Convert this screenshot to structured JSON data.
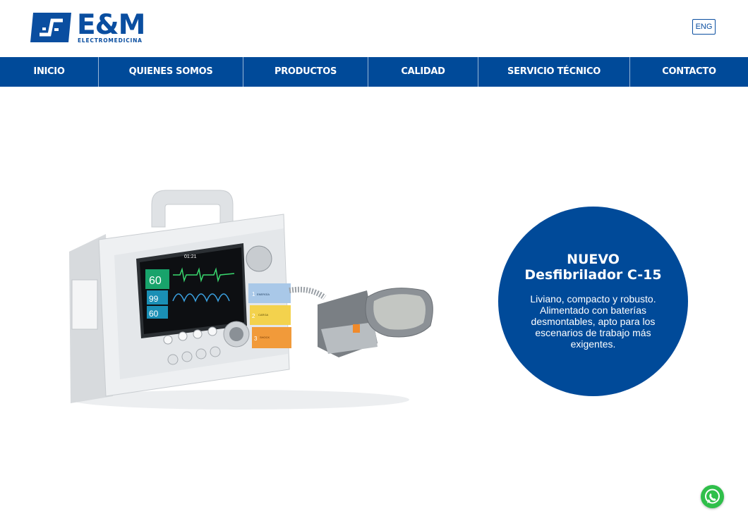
{
  "brand": {
    "name": "E&M",
    "subtitle": "ELECTROMEDICINA",
    "color": "#0a4ea0"
  },
  "header": {
    "language_button": "ENG"
  },
  "nav": {
    "background": "#004a99",
    "items": [
      {
        "label": "INICIO"
      },
      {
        "label": "QUIENES SOMOS"
      },
      {
        "label": "PRODUCTOS"
      },
      {
        "label": "CALIDAD"
      },
      {
        "label": "SERVICIO TÉCNICO"
      },
      {
        "label": "CONTACTO"
      }
    ]
  },
  "hero": {
    "product_image": "defibrillator-image",
    "screen": {
      "time": "01:21",
      "hr": "60",
      "spo2": "99",
      "pulse": "60"
    },
    "panel": {
      "step1": "ENERGÍA",
      "step2": "CARGA",
      "step3": "SHOCK",
      "num1": "1",
      "num2": "2",
      "num3": "3"
    },
    "promo": {
      "title_line1": "NUEVO",
      "title_line2": "Desfibrilador C-15",
      "description": "Liviano, compacto y robusto. Alimentado con baterías desmontables, apto para los escenarios de trabajo más exigentes."
    }
  },
  "floating": {
    "whatsapp_icon": "whatsapp-icon",
    "color": "#2fbf4a"
  }
}
